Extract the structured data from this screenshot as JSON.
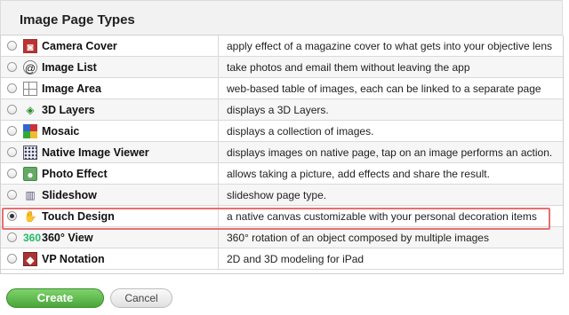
{
  "header": {
    "title": "Image Page Types"
  },
  "rows": [
    {
      "name": "Camera Cover",
      "icon": "camera-cover-icon",
      "desc": "apply effect of a magazine cover to what gets into your objective lens",
      "selected": false
    },
    {
      "name": "Image List",
      "icon": "image-list-icon",
      "desc": "take photos and email them without leaving the app",
      "selected": false
    },
    {
      "name": "Image Area",
      "icon": "image-area-icon",
      "desc": "web-based table of images, each can be linked to a separate page",
      "selected": false
    },
    {
      "name": "3D Layers",
      "icon": "3d-layers-icon",
      "desc": "displays a 3D Layers.",
      "selected": false
    },
    {
      "name": "Mosaic",
      "icon": "mosaic-icon",
      "desc": "displays a collection of images.",
      "selected": false
    },
    {
      "name": "Native Image Viewer",
      "icon": "native-image-viewer-icon",
      "desc": "displays images on native page, tap on an image performs an action.",
      "selected": false
    },
    {
      "name": "Photo Effect",
      "icon": "photo-effect-icon",
      "desc": "allows taking a picture, add effects and share the result.",
      "selected": false
    },
    {
      "name": "Slideshow",
      "icon": "slideshow-icon",
      "desc": "slideshow page type.",
      "selected": false
    },
    {
      "name": "Touch Design",
      "icon": "touch-design-icon",
      "desc": "a native canvas customizable with your personal decoration items",
      "selected": true
    },
    {
      "name": "360° View",
      "icon": "360-view-icon",
      "desc": "360° rotation of an object composed by multiple images",
      "selected": false
    },
    {
      "name": "VP Notation",
      "icon": "vp-notation-icon",
      "desc": "2D and 3D modeling for iPad",
      "selected": false
    }
  ],
  "buttons": {
    "create": "Create",
    "cancel": "Cancel"
  },
  "colors": {
    "highlight": "#e76f6f",
    "create_green": "#4aa63a"
  }
}
